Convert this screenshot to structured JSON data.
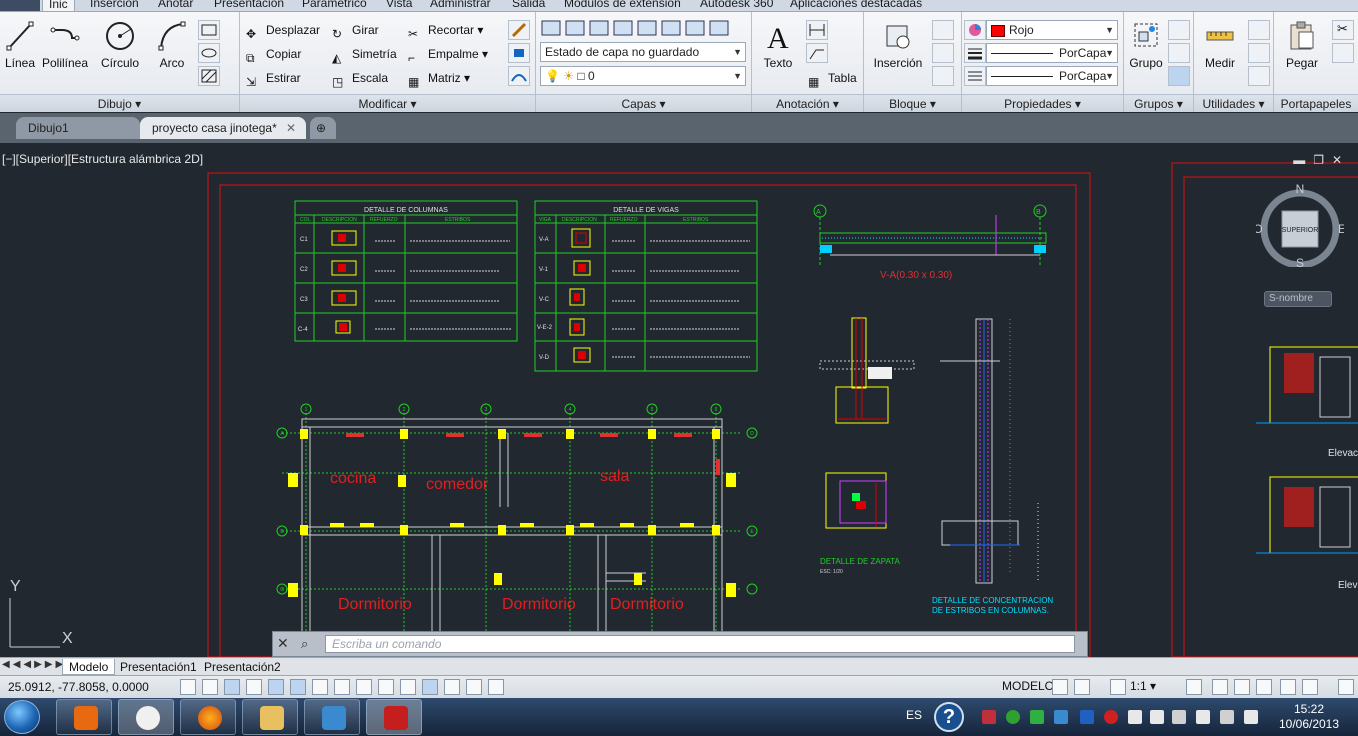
{
  "menu_tabs": [
    "Inic",
    "Inserción",
    "Anotar",
    "Presentación",
    "Paramétrico",
    "Vista",
    "Administrar",
    "Salida",
    "Módulos de extensión",
    "Autodesk 360",
    "Aplicaciones destacadas"
  ],
  "ribbon": {
    "dibujo": {
      "title": "Dibujo",
      "linea": "Línea",
      "polilinea": "Polilínea",
      "circulo": "Círculo",
      "arco": "Arco"
    },
    "modificar": {
      "title": "Modificar",
      "desplazar": "Desplazar",
      "girar": "Girar",
      "recortar": "Recortar",
      "copiar": "Copiar",
      "simetria": "Simetría",
      "empalme": "Empalme",
      "estirar": "Estirar",
      "escala": "Escala",
      "matriz": "Matriz"
    },
    "capas": {
      "title": "Capas",
      "layer_state": "Estado de capa no guardado",
      "current_layer": "0"
    },
    "anotacion": {
      "title": "Anotación",
      "texto": "Texto",
      "tabla": "Tabla"
    },
    "bloque": {
      "title": "Bloque",
      "insercion": "Inserción"
    },
    "propiedades": {
      "title": "Propiedades",
      "color": "Rojo",
      "linetype": "PorCapa",
      "lineweight": "PorCapa",
      "color_hex": "#ff0000"
    },
    "grupos": {
      "title": "Grupos",
      "grupo": "Grupo"
    },
    "utilidades": {
      "title": "Utilidades",
      "medir": "Medir"
    },
    "portapapeles": {
      "title": "Portapapeles",
      "pegar": "Pegar"
    }
  },
  "doc_tabs": [
    "Dibujo1",
    "proyecto casa jinotega*"
  ],
  "viewport_label": "[−][Superior][Estructura alámbrica 2D]",
  "drawing": {
    "columnas": {
      "title": "DETALLE DE COLUMNAS",
      "headers": [
        "COL.",
        "DESCRIPCION",
        "REFUERZO",
        "ESTRIBOS"
      ],
      "rows": [
        "C1",
        "C2",
        "C3",
        "C-4"
      ]
    },
    "vigas": {
      "title": "DETALLE DE VIGAS",
      "headers": [
        "VIGA",
        "DESCRIPCION",
        "REFUERZO",
        "ESTRIBOS"
      ],
      "rows": [
        "V-A",
        "V-1",
        "V-C",
        "V-E-2",
        "V-D"
      ]
    },
    "rooms": [
      "cocina",
      "comedor",
      "sala",
      "Dormitorio",
      "Dormitorio",
      "Dormitorio"
    ],
    "beam_label": "V-A(0.30 x 0.30)",
    "zapata_label": "DETALLE DE ZAPATA",
    "zapata_sub": "ESC: 1/20",
    "concentracion_label": [
      "DETALLE DE CONCENTRACION",
      "DE ESTRIBOS EN COLUMNAS."
    ],
    "grid_top": [
      "1",
      "2",
      "3",
      "4",
      "5",
      "6"
    ],
    "grid_side": [
      "A",
      "B",
      "C",
      "D",
      "E"
    ]
  },
  "cmd_placeholder": "Escriba un comando",
  "navcube": {
    "N": "N",
    "S": "S",
    "E": "E",
    "O": "O",
    "top": "SUPERIOR",
    "wcs": "S-nombre"
  },
  "elev_labels": [
    "Elevac",
    "Elev"
  ],
  "layout_tabs": [
    "Modelo",
    "Presentación1",
    "Presentación2"
  ],
  "status": {
    "coords": "25.0912, -77.8058, 0.0000",
    "model": "MODELO",
    "scale": "1:1"
  },
  "taskbar": {
    "lang": "ES",
    "time": "15:22",
    "date": "10/06/2013"
  }
}
